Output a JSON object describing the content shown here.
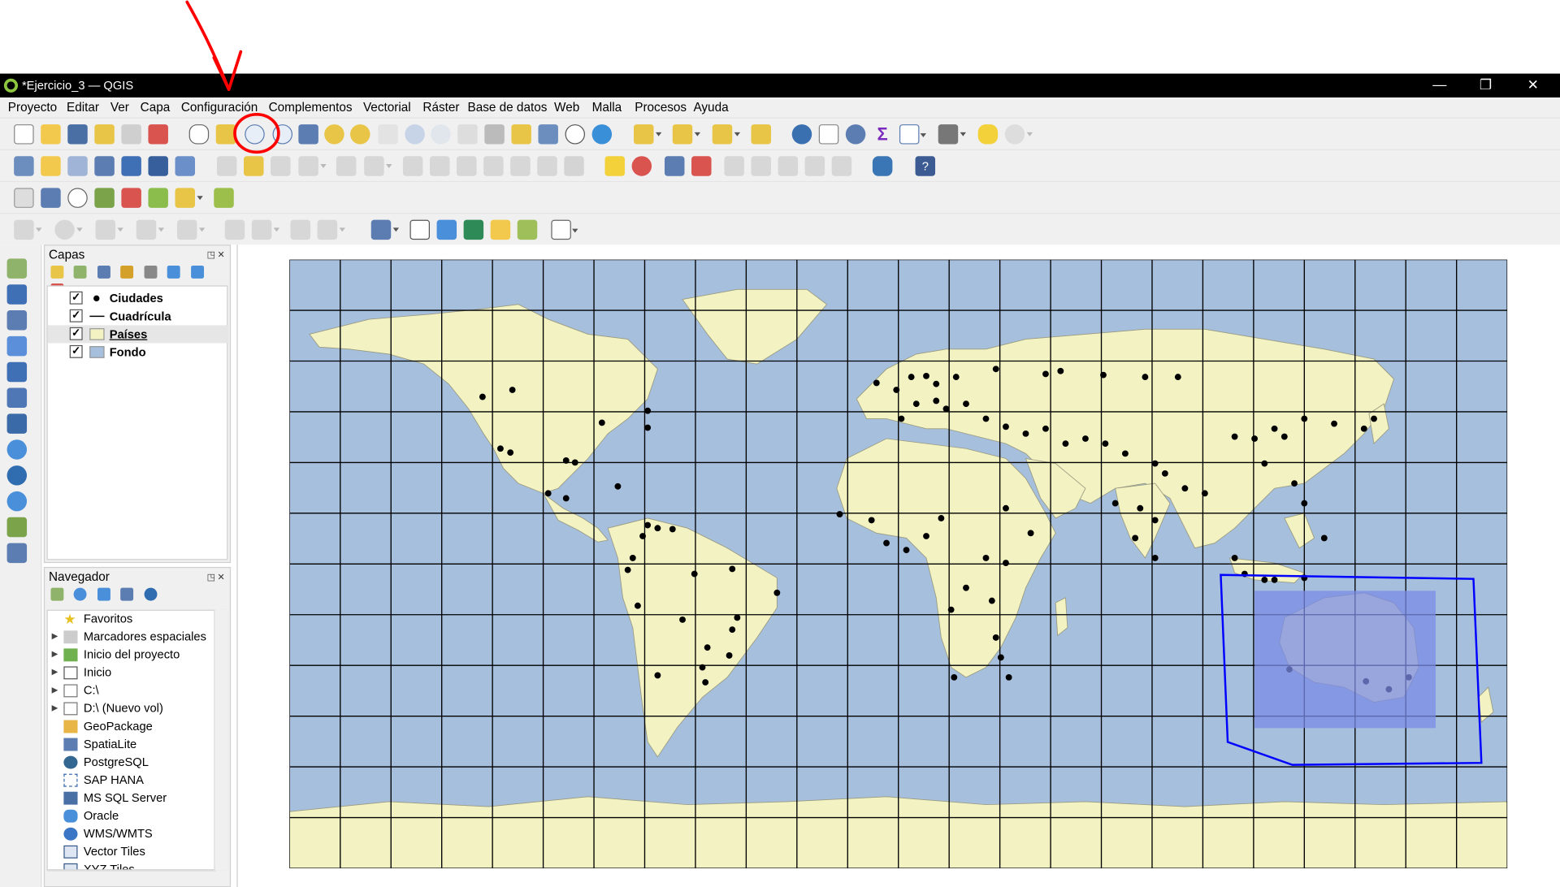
{
  "window": {
    "title": "*Ejercicio_3 — QGIS",
    "controls": [
      "—",
      "❐",
      "✕"
    ]
  },
  "menubar": [
    "Proyecto",
    "Editar",
    "Ver",
    "Capa",
    "Configuración",
    "Complementos",
    "Vectorial",
    "Ráster",
    "Base de datos",
    "Web",
    "Malla",
    "Procesos",
    "Ayuda"
  ],
  "layers_panel": {
    "title": "Capas",
    "layers": [
      {
        "name": "Ciudades",
        "checked": true,
        "symbol": "point"
      },
      {
        "name": "Cuadrícula",
        "checked": true,
        "symbol": "line"
      },
      {
        "name": "Países",
        "checked": true,
        "symbol": "fill-yellow",
        "selected": true
      },
      {
        "name": "Fondo",
        "checked": true,
        "symbol": "fill-blue"
      }
    ]
  },
  "browser_panel": {
    "title": "Navegador",
    "items": [
      {
        "label": "Favoritos",
        "icon": "star-icon",
        "expandable": false
      },
      {
        "label": "Marcadores espaciales",
        "icon": "bookmark-icon",
        "expandable": true
      },
      {
        "label": "Inicio del proyecto",
        "icon": "project-home-icon",
        "expandable": true
      },
      {
        "label": "Inicio",
        "icon": "home-icon",
        "expandable": true
      },
      {
        "label": "C:\\",
        "icon": "folder-icon",
        "expandable": true
      },
      {
        "label": "D:\\ (Nuevo vol)",
        "icon": "folder-icon",
        "expandable": true
      },
      {
        "label": "GeoPackage",
        "icon": "geopackage-icon",
        "expandable": false
      },
      {
        "label": "SpatiaLite",
        "icon": "spatialite-icon",
        "expandable": false
      },
      {
        "label": "PostgreSQL",
        "icon": "postgresql-icon",
        "expandable": false
      },
      {
        "label": "SAP HANA",
        "icon": "sap-hana-icon",
        "expandable": false
      },
      {
        "label": "MS SQL Server",
        "icon": "mssql-icon",
        "expandable": false
      },
      {
        "label": "Oracle",
        "icon": "oracle-icon",
        "expandable": false
      },
      {
        "label": "WMS/WMTS",
        "icon": "wms-icon",
        "expandable": false
      },
      {
        "label": "Vector Tiles",
        "icon": "vector-tiles-icon",
        "expandable": false
      },
      {
        "label": "XYZ Tiles",
        "icon": "xyz-tiles-icon",
        "expandable": false
      }
    ]
  },
  "map": {
    "ocean_color": "#a5bfdd",
    "land_color": "#f2f2c2",
    "grid_color": "#000000",
    "point_color": "#000000",
    "zoom_selection_fill": "#7b8be6",
    "annotation_color": "#ff0000",
    "hand_drawn_box_color": "#0000ff"
  },
  "annotation": {
    "target": "zoom-in-tool",
    "shape": "red arrow and circle"
  }
}
